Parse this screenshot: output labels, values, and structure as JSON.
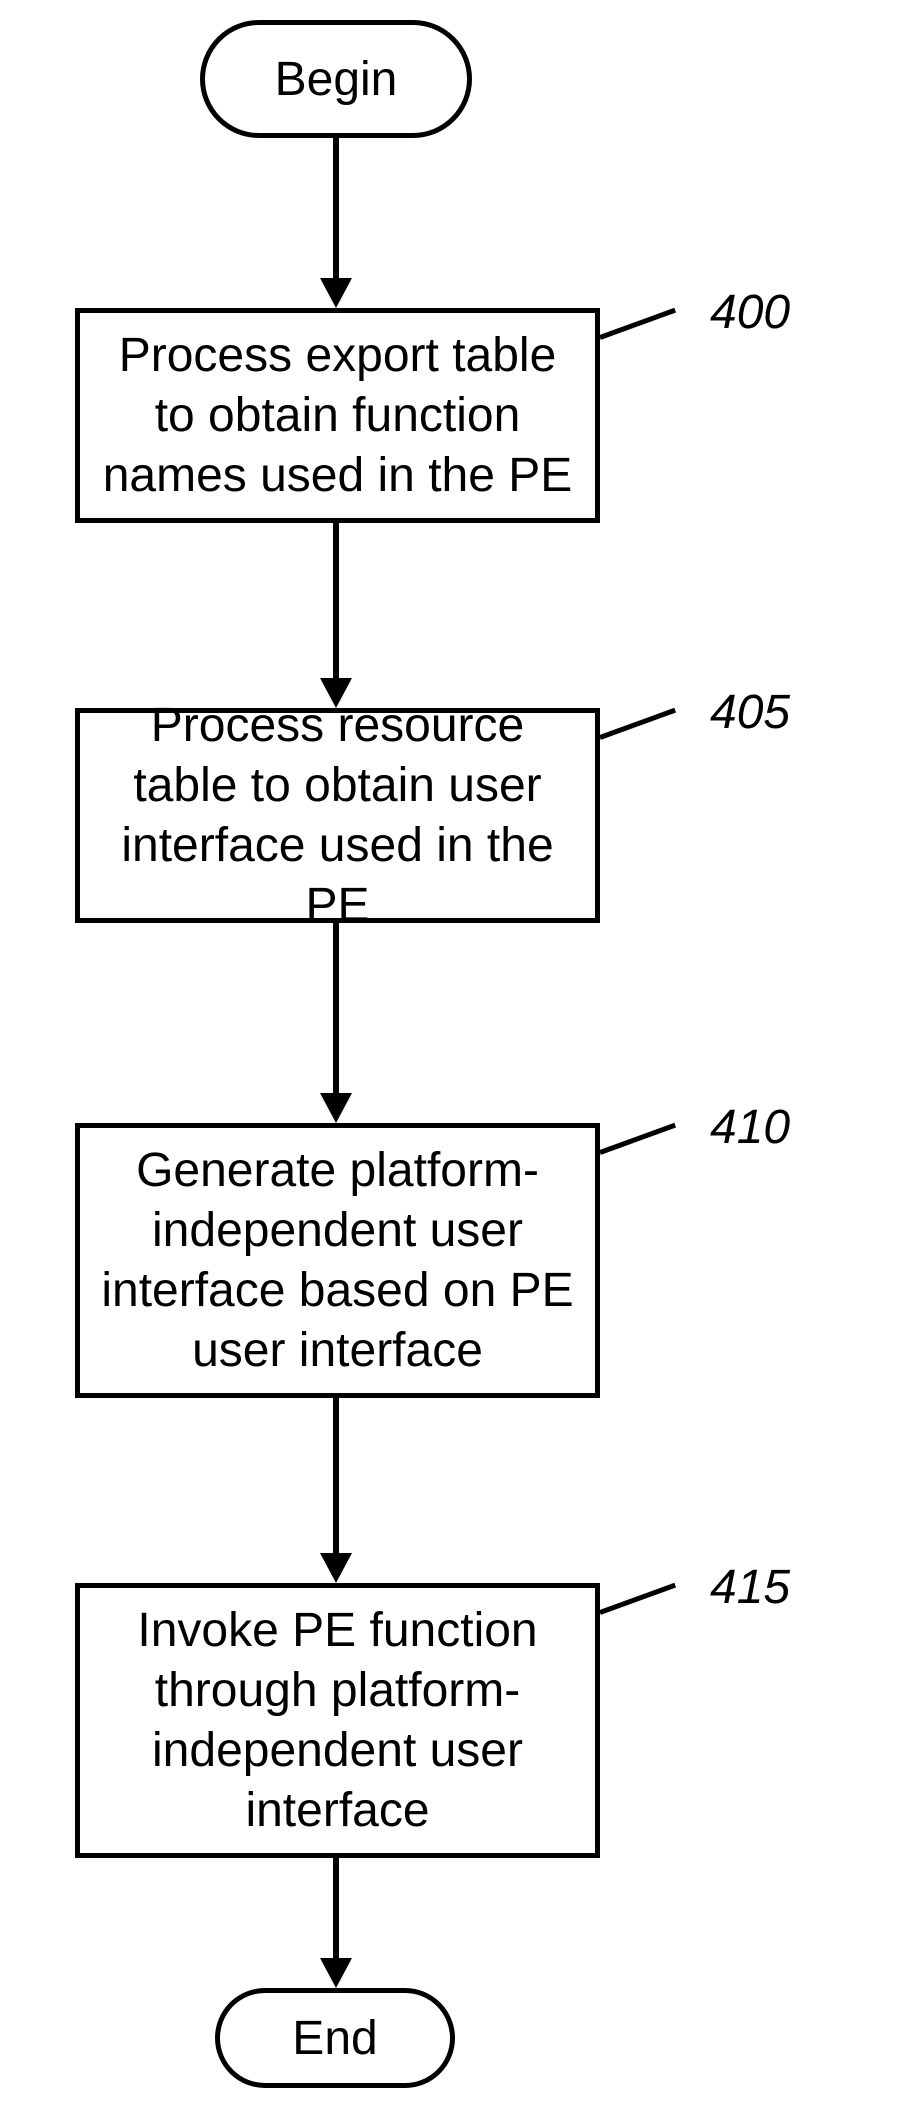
{
  "terminators": {
    "begin": "Begin",
    "end": "End"
  },
  "steps": {
    "s400": {
      "text": "Process export table to obtain function names used in the PE",
      "ref": "400"
    },
    "s405": {
      "text": "Process resource table to obtain user interface used in the PE",
      "ref": "405"
    },
    "s410": {
      "text": "Generate platform-independent user interface based on PE user interface",
      "ref": "410"
    },
    "s415": {
      "text": "Invoke PE function through platform-independent user interface",
      "ref": "415"
    }
  }
}
